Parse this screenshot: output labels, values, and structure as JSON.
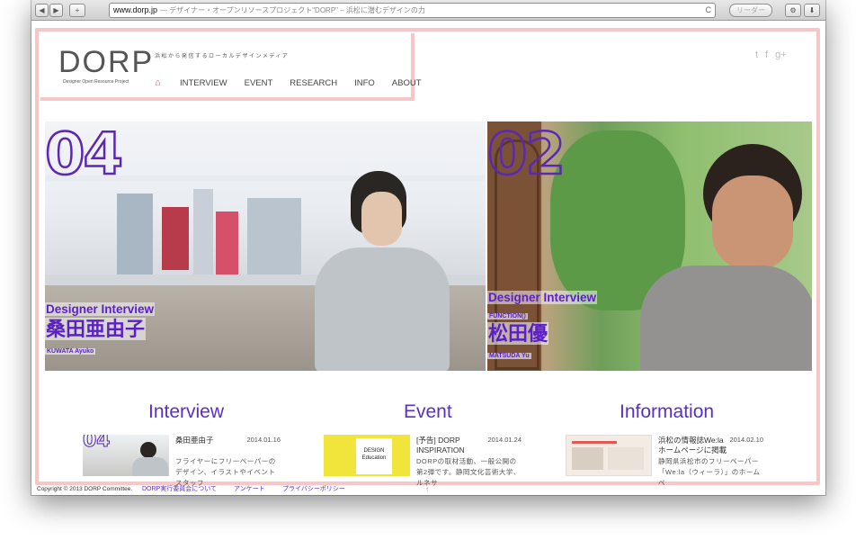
{
  "browser": {
    "back": "◀",
    "forward": "▶",
    "add": "+",
    "url": "www.dorp.jp",
    "title": "— デザイナー・オープンリソースプロジェクト\"DORP\" – 浜松に潜むデザインの力",
    "reload": "C",
    "reader": "リーダー",
    "wrench": "⚙",
    "download": "⬇"
  },
  "header": {
    "logo": "DORP",
    "logo_sub": "Designer Open Resource Project",
    "tagline": "浜松から発信するローカルデザインメディア",
    "nav": [
      "INTERVIEW",
      "EVENT",
      "RESEARCH",
      "INFO",
      "ABOUT"
    ],
    "home": "⌂",
    "social": [
      "t",
      "f",
      "g+"
    ]
  },
  "hero": [
    {
      "number": "04",
      "label": "Designer Interview",
      "name": "桑田亜由子",
      "romaji": "KUWATA Ayuko"
    },
    {
      "number": "02",
      "label": "Designer Interview",
      "company": "FUNCTION()",
      "name": "松田優",
      "romaji": "MATSUDA Yu"
    }
  ],
  "sections": {
    "interview": {
      "title": "Interview",
      "card_title": "桑田亜由子",
      "date": "2014.01.16",
      "desc": "フライヤーにフリーペーパーのデザイン、イラストやイベントスタッフ",
      "thumb_num": "04"
    },
    "event": {
      "title": "Event",
      "card_title": "[予告] DORP INSPIRATION",
      "date": "2014.01.24",
      "desc": "DORPの取材活動、一般公開の第2弾です。静岡文化芸術大学、ルネサ",
      "thumb_text": "DESIGN Education"
    },
    "information": {
      "title": "Information",
      "card_title": "浜松の情報誌We:la ホームページに掲載",
      "date": "2014.02.10",
      "desc": "静岡県浜松市のフリーペーパー「We:la（ウィーラ）」のホームペ"
    }
  },
  "footer": {
    "copyright": "Copyright © 2013 DORP Committee.",
    "links": [
      "DORP実行委員会について",
      "アンケート",
      "プライバシーポリシー"
    ],
    "up": "↑"
  }
}
